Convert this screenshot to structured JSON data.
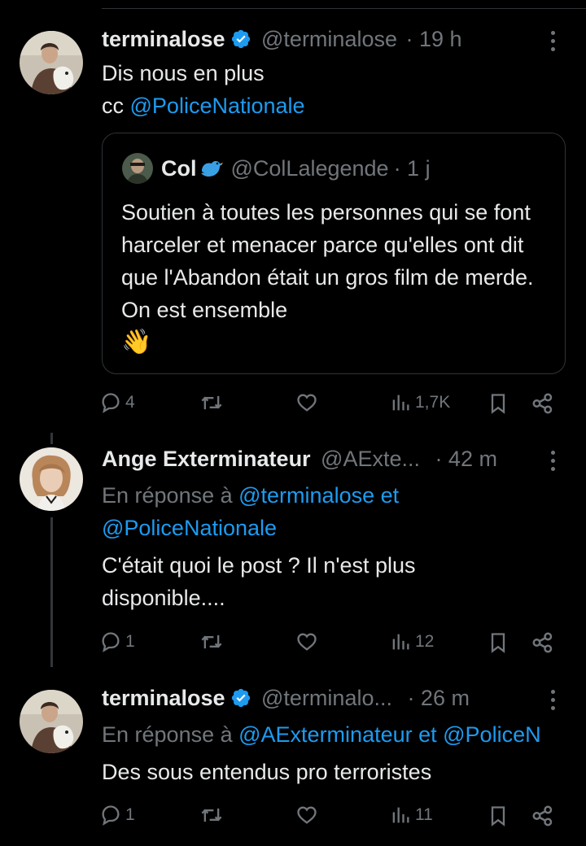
{
  "tweets": [
    {
      "name": "terminalose",
      "handle": "@terminalose",
      "time": "· 19 h",
      "text_line1": "Dis nous en plus",
      "text_cc": "cc ",
      "mention": "@PoliceNationale",
      "quote": {
        "name": "Col",
        "handle": "@ColLalegende",
        "time": "· 1 j",
        "text": "Soutien à toutes les personnes qui se font harceler et menacer parce qu'elles ont dit que l'Abandon était un gros film de merde. On est ensemble",
        "emoji": "👋"
      },
      "actions": {
        "replies": "4",
        "retweets": "",
        "likes": "",
        "views": "1,7K"
      }
    },
    {
      "name": "Ange Exterminateur",
      "handle": "@AExte...",
      "time": "· 42 m",
      "reply_prefix": "En réponse à ",
      "reply_to_1": "@terminalose",
      "reply_joiner": " et",
      "reply_to_2": "@PoliceNationale",
      "text": "C'était quoi le post ? Il n'est plus disponible....",
      "actions": {
        "replies": "1",
        "retweets": "",
        "likes": "",
        "views": "12"
      }
    },
    {
      "name": "terminalose",
      "handle": "@terminalo...",
      "time": "· 26 m",
      "reply_prefix": "En réponse à ",
      "reply_to_1": "@AExterminateur",
      "reply_joiner": " et ",
      "reply_to_2": "@PoliceN",
      "text": "Des sous entendus pro terroristes",
      "actions": {
        "replies": "1",
        "retweets": "",
        "likes": "",
        "views": "11"
      }
    }
  ],
  "colors": {
    "background": "#000000",
    "text": "#e7e9ea",
    "muted": "#71767b",
    "link": "#1d9bf0",
    "verified": "#1d9bf0",
    "border": "#2f3336"
  },
  "icons": [
    "verified-badge-icon",
    "more-icon",
    "reply-icon",
    "retweet-icon",
    "like-icon",
    "views-icon",
    "bookmark-icon",
    "share-icon",
    "bird-emoji-icon"
  ]
}
